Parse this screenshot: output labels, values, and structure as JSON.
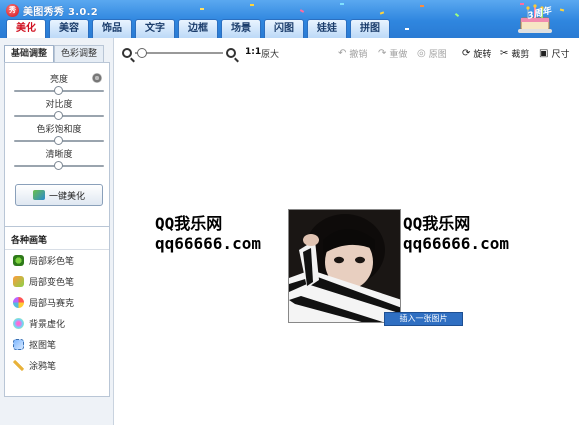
{
  "app": {
    "title": "美图秀秀 3.0.2",
    "logo_text": "秀"
  },
  "tabs": [
    {
      "label": "美化",
      "active": true
    },
    {
      "label": "美容"
    },
    {
      "label": "饰品"
    },
    {
      "label": "文字"
    },
    {
      "label": "边框"
    },
    {
      "label": "场景"
    },
    {
      "label": "闪图"
    },
    {
      "label": "娃娃"
    },
    {
      "label": "拼图"
    }
  ],
  "badge": {
    "years": "3周年"
  },
  "left_panel": {
    "subtabs": [
      {
        "label": "基础调整",
        "active": true
      },
      {
        "label": "色彩调整"
      }
    ],
    "sliders": [
      {
        "label": "亮度",
        "value": 0.5
      },
      {
        "label": "对比度",
        "value": 0.5
      },
      {
        "label": "色彩饱和度",
        "value": 0.5
      },
      {
        "label": "清晰度",
        "value": 0.5
      }
    ],
    "one_key_button": "一键美化",
    "pens_title": "各种画笔",
    "pens": [
      "局部彩色笔",
      "局部变色笔",
      "局部马赛克",
      "背景虚化",
      "抠图笔",
      "涂鸦笔"
    ]
  },
  "toolbar": {
    "zoom_level": 0.05,
    "ratio": "1:1",
    "ratio_label": "原大",
    "undo": "撤销",
    "redo": "重做",
    "original": "原图",
    "rotate": "旋转",
    "crop": "裁剪",
    "size": "尺寸"
  },
  "canvas": {
    "watermark_left": [
      "QQ我乐网",
      "qq66666.com"
    ],
    "watermark_right": [
      "QQ我乐网",
      "qq66666.com"
    ],
    "context_menu_item": "插入一张图片"
  },
  "colors": {
    "header": "#2f86df",
    "active_tab_text": "#d01020",
    "menu_highlight": "#2f6fc2"
  }
}
